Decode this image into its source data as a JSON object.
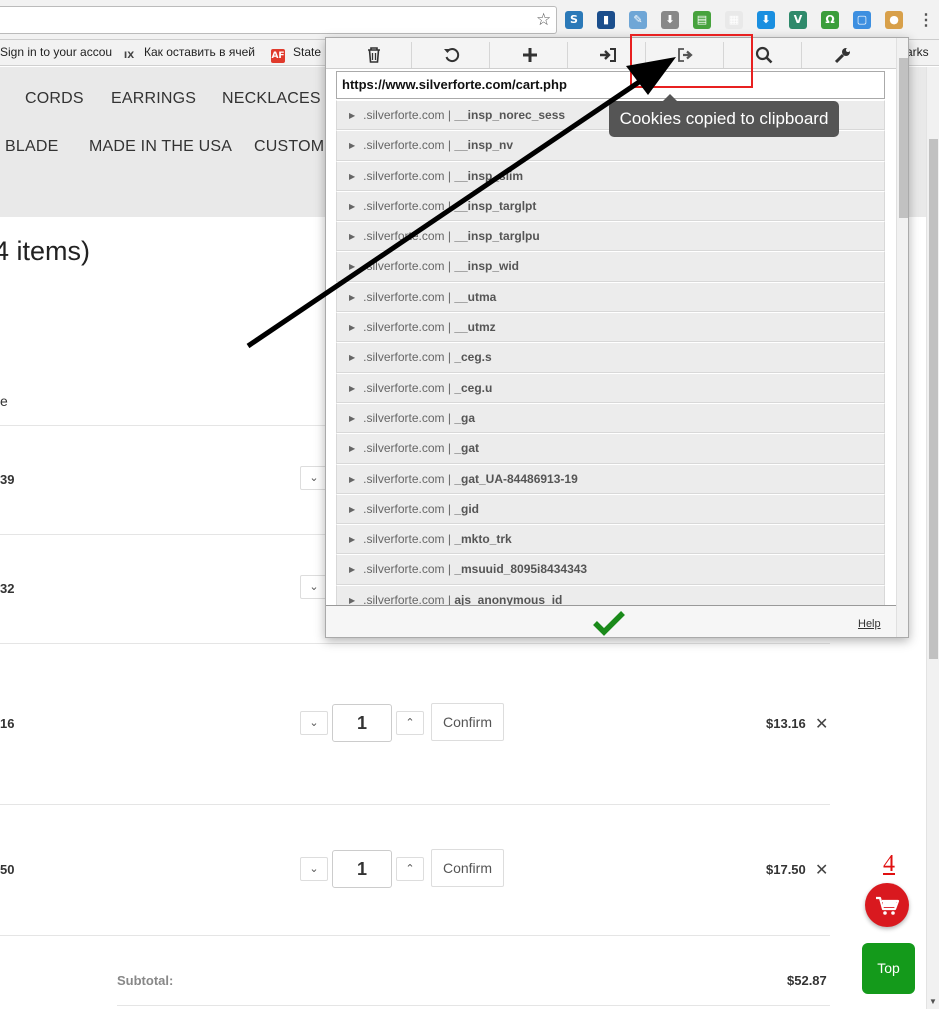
{
  "browser": {
    "bookmarks": [
      {
        "label": "Sign in to your accou",
        "icon": "page-icon",
        "color": "#f2f2f2"
      },
      {
        "label": "Как оставить в ячей",
        "icon": "ix-icon",
        "color": "#f2f2f2"
      },
      {
        "label": "State",
        "icon": "af-icon",
        "color": "#e03a2c"
      }
    ],
    "bookmarks_overflow": "arks",
    "extensions": [
      {
        "icon": "s-extension-icon",
        "glyph": "S",
        "color": "#2b79b8"
      },
      {
        "icon": "bar-chart-extension-icon",
        "glyph": "▮",
        "color": "#1b4e8c"
      },
      {
        "icon": "feather-extension-icon",
        "glyph": "✎",
        "color": "#6fa6d6"
      },
      {
        "icon": "download-page-icon",
        "glyph": "⬇",
        "color": "#888888"
      },
      {
        "icon": "print-extension-icon",
        "glyph": "▤",
        "color": "#47a23d"
      },
      {
        "icon": "calendar-extension-icon",
        "glyph": "▦",
        "color": "#e9e9e9"
      },
      {
        "icon": "download-arrow-icon",
        "glyph": "⬇",
        "color": "#1a8fe0"
      },
      {
        "icon": "vpn-extension-icon",
        "glyph": "V",
        "color": "#2f8a6b"
      },
      {
        "icon": "omega-extension-icon",
        "glyph": "Ω",
        "color": "#3b9e3b"
      },
      {
        "icon": "window-extension-icon",
        "glyph": "▢",
        "color": "#3d8fe0"
      },
      {
        "icon": "cookie-extension-icon",
        "glyph": "●",
        "color": "#d8a04a"
      }
    ]
  },
  "nav": {
    "row1": [
      "CORDS",
      "EARRINGS",
      "NECKLACES"
    ],
    "row2": [
      "BLADE",
      "MADE IN THE USA",
      "CUSTOME"
    ]
  },
  "cart": {
    "title": "4 items)",
    "column_header": "e",
    "rows": [
      {
        "price": "39"
      },
      {
        "price": "32"
      },
      {
        "price": "16",
        "qty": "1",
        "confirm": "Confirm",
        "total": "$13.16"
      },
      {
        "price": "50",
        "qty": "1",
        "confirm": "Confirm",
        "total": "$17.50"
      }
    ],
    "subtotal_label": "Subtotal:",
    "subtotal_value": "$52.87",
    "badge_count": "4",
    "top_label": "Top"
  },
  "popup": {
    "url": "https://www.silverforte.com/cart.php",
    "domain": ".silverforte.com",
    "separator": "|",
    "cookies": [
      "__insp_norec_sess",
      "__insp_nv",
      "__insp_slim",
      "__insp_targlpt",
      "__insp_targlpu",
      "__insp_wid",
      "__utma",
      "__utmz",
      "_ceg.s",
      "_ceg.u",
      "_ga",
      "_gat",
      "_gat_UA-84486913-19",
      "_gid",
      "_mkto_trk",
      "_msuuid_8095i8434343",
      "ajs_anonymous_id"
    ],
    "help_label": "Help",
    "tooltip": "Cookies copied to clipboard",
    "check_color": "#1a8a1a"
  }
}
